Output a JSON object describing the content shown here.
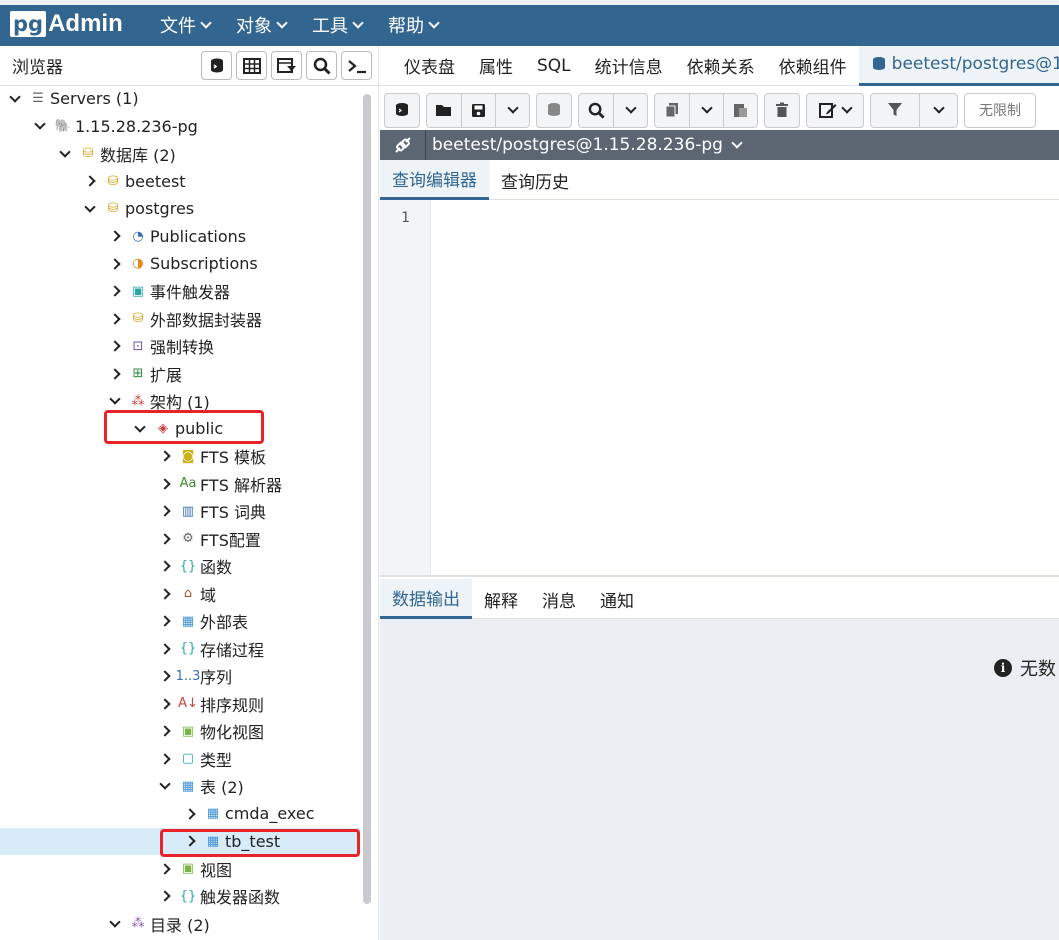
{
  "app": {
    "logo_pg": "pg",
    "logo_admin": "Admin",
    "brand_color": "#326690"
  },
  "menu": [
    {
      "label": "文件"
    },
    {
      "label": "对象"
    },
    {
      "label": "工具"
    },
    {
      "label": "帮助"
    }
  ],
  "browser": {
    "title": "浏览器",
    "tree": [
      {
        "label": "Servers (1)",
        "icon": "servers-icon",
        "glyph": "☰",
        "color": "#666",
        "state": "open"
      },
      {
        "label": "1.15.28.236-pg",
        "icon": "elephant-icon",
        "glyph": "🐘",
        "color": "#336791",
        "state": "open"
      },
      {
        "label": "数据库 (2)",
        "icon": "databases-icon",
        "glyph": "⛁",
        "color": "#d4a017",
        "state": "open"
      },
      {
        "label": "beetest",
        "icon": "database-icon",
        "glyph": "⛁",
        "color": "#d4a017",
        "state": "closed"
      },
      {
        "label": "postgres",
        "icon": "database-icon",
        "glyph": "⛁",
        "color": "#d4a017",
        "state": "open"
      },
      {
        "label": "Publications",
        "icon": "publication-icon",
        "glyph": "◔",
        "color": "#3b6fb5",
        "state": "closed"
      },
      {
        "label": "Subscriptions",
        "icon": "subscription-icon",
        "glyph": "◑",
        "color": "#e08a1e",
        "state": "closed"
      },
      {
        "label": "事件触发器",
        "icon": "event-trigger-icon",
        "glyph": "▣",
        "color": "#2aa4a8",
        "state": "closed"
      },
      {
        "label": "外部数据封装器",
        "icon": "foreign-data-wrapper-icon",
        "glyph": "⛁",
        "color": "#d4a017",
        "state": "closed"
      },
      {
        "label": "强制转换",
        "icon": "cast-icon",
        "glyph": "⊡",
        "color": "#6a4fb5",
        "state": "closed"
      },
      {
        "label": "扩展",
        "icon": "extension-icon",
        "glyph": "⊞",
        "color": "#2f8a3a",
        "state": "closed"
      },
      {
        "label": "架构 (1)",
        "icon": "schemas-icon",
        "glyph": "⁂",
        "color": "#d0403a",
        "state": "open"
      },
      {
        "label": "public",
        "icon": "schema-icon",
        "glyph": "◈",
        "color": "#d0403a",
        "state": "open"
      },
      {
        "label": "FTS 模板",
        "icon": "fts-template-icon",
        "glyph": "◙",
        "color": "#c9b21a",
        "state": "closed"
      },
      {
        "label": "FTS 解析器",
        "icon": "fts-parser-icon",
        "glyph": "Aa",
        "color": "#3c8a2e",
        "state": "closed"
      },
      {
        "label": "FTS 词典",
        "icon": "fts-dictionary-icon",
        "glyph": "▥",
        "color": "#3b6fb5",
        "state": "closed"
      },
      {
        "label": "FTS配置",
        "icon": "fts-configuration-icon",
        "glyph": "⚙",
        "color": "#666",
        "state": "closed"
      },
      {
        "label": "函数",
        "icon": "function-icon",
        "glyph": "{}",
        "color": "#2aa4a8",
        "state": "closed"
      },
      {
        "label": "域",
        "icon": "domain-icon",
        "glyph": "⌂",
        "color": "#a0522d",
        "state": "closed"
      },
      {
        "label": "外部表",
        "icon": "foreign-table-icon",
        "glyph": "▦",
        "color": "#3b8fd5",
        "state": "closed"
      },
      {
        "label": "存储过程",
        "icon": "procedure-icon",
        "glyph": "{}",
        "color": "#2aa4a8",
        "state": "closed"
      },
      {
        "label": "序列",
        "icon": "sequence-icon",
        "glyph": "1..3",
        "color": "#3b6fb5",
        "state": "closed"
      },
      {
        "label": "排序规则",
        "icon": "collation-icon",
        "glyph": "A↓",
        "color": "#d0403a",
        "state": "closed"
      },
      {
        "label": "物化视图",
        "icon": "materialized-view-icon",
        "glyph": "▣",
        "color": "#7cb342",
        "state": "closed"
      },
      {
        "label": "类型",
        "icon": "type-icon",
        "glyph": "▢",
        "color": "#2aa4a8",
        "state": "closed"
      },
      {
        "label": "表 (2)",
        "icon": "tables-icon",
        "glyph": "▦",
        "color": "#3b8fd5",
        "state": "open"
      },
      {
        "label": "cmda_exec",
        "icon": "table-icon",
        "glyph": "▦",
        "color": "#3b8fd5",
        "state": "closed"
      },
      {
        "label": "tb_test",
        "icon": "table-icon",
        "glyph": "▦",
        "color": "#3b8fd5",
        "state": "closed",
        "selected": true
      },
      {
        "label": "视图",
        "icon": "view-icon",
        "glyph": "▣",
        "color": "#7cb342",
        "state": "closed"
      },
      {
        "label": "触发器函数",
        "icon": "trigger-function-icon",
        "glyph": "{}",
        "color": "#2aa4a8",
        "state": "closed"
      },
      {
        "label": "目录 (2)",
        "icon": "catalogs-icon",
        "glyph": "⁂",
        "color": "#8e5bb5",
        "state": "open"
      }
    ]
  },
  "tabs": [
    {
      "label": "仪表盘"
    },
    {
      "label": "属性"
    },
    {
      "label": "SQL"
    },
    {
      "label": "统计信息"
    },
    {
      "label": "依赖关系"
    },
    {
      "label": "依赖组件"
    },
    {
      "label": "beetest/postgres@1."
    }
  ],
  "toolbar": {
    "limit_label": "无限制"
  },
  "connection": {
    "label": "beetest/postgres@1.15.28.236-pg"
  },
  "query_tabs": [
    {
      "label": "查询编辑器"
    },
    {
      "label": "查询历史"
    }
  ],
  "editor": {
    "line_number": "1"
  },
  "output_tabs": [
    {
      "label": "数据输出"
    },
    {
      "label": "解释"
    },
    {
      "label": "消息"
    },
    {
      "label": "通知"
    }
  ],
  "output": {
    "no_data": "无数"
  }
}
